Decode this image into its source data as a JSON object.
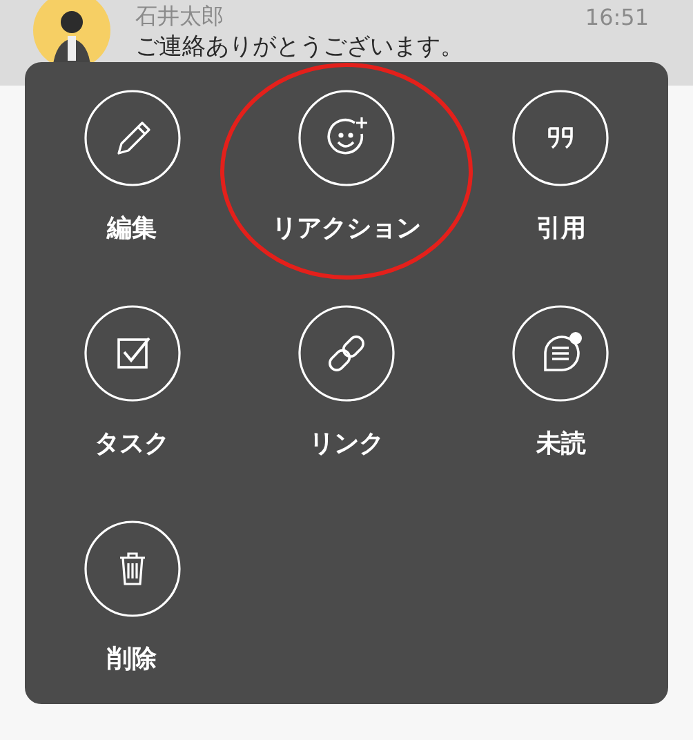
{
  "message": {
    "sender": "石井太郎",
    "time": "16:51",
    "text": "ご連絡ありがとうございます。"
  },
  "actions": [
    {
      "label": "編集",
      "kind": "edit",
      "highlighted": false
    },
    {
      "label": "リアクション",
      "kind": "reaction",
      "highlighted": true
    },
    {
      "label": "引用",
      "kind": "quote",
      "highlighted": false
    },
    {
      "label": "タスク",
      "kind": "task",
      "highlighted": false
    },
    {
      "label": "リンク",
      "kind": "link",
      "highlighted": false
    },
    {
      "label": "未読",
      "kind": "unread",
      "highlighted": false
    },
    {
      "label": "削除",
      "kind": "delete",
      "highlighted": false
    }
  ]
}
